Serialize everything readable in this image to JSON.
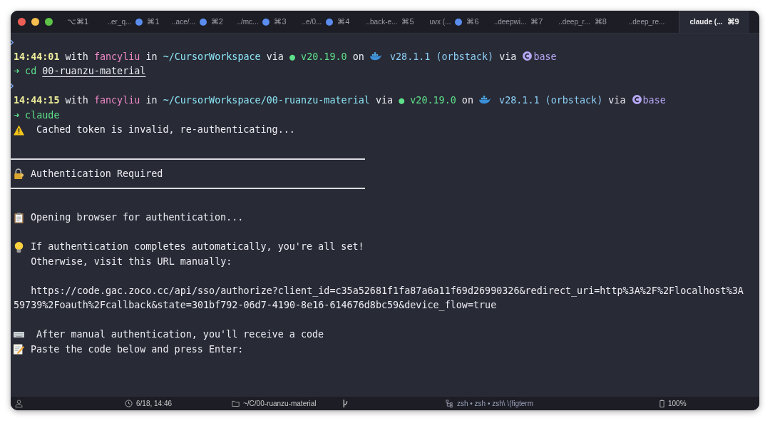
{
  "window": {
    "label": "⌥⌘1"
  },
  "tabs": [
    {
      "title": "..er_q...",
      "dot": true,
      "shortcut": "⌘1",
      "selected": false
    },
    {
      "title": "..ace/...",
      "dot": true,
      "shortcut": "⌘2",
      "selected": false
    },
    {
      "title": "../mc...",
      "dot": true,
      "shortcut": "⌘3",
      "selected": false
    },
    {
      "title": "..e/0...",
      "dot": true,
      "shortcut": "⌘4",
      "selected": false
    },
    {
      "title": "..back-e...",
      "dot": false,
      "shortcut": "⌘5",
      "selected": false
    },
    {
      "title": "uvx (...",
      "dot": true,
      "shortcut": "⌘6",
      "selected": false
    },
    {
      "title": "..deepwi...",
      "dot": false,
      "shortcut": "⌘7",
      "selected": false
    },
    {
      "title": "..deep_r...",
      "dot": false,
      "shortcut": "⌘8",
      "selected": false
    },
    {
      "title": "..deep_re...",
      "dot": false,
      "selected": false
    },
    {
      "title": "claude (...",
      "dot": false,
      "shortcut": "⌘9",
      "selected": true
    }
  ],
  "terminal": {
    "lines": [
      {
        "kind": "mark"
      },
      {
        "kind": "text",
        "segments": [
          {
            "kind": "time",
            "text": "14:44:01"
          },
          {
            "kind": "plain",
            "text": " with "
          },
          {
            "kind": "user",
            "text": "fancyliu"
          },
          {
            "kind": "plain",
            "text": " in "
          },
          {
            "kind": "path",
            "text": "~/CursorWorkspace"
          },
          {
            "kind": "plain",
            "text": " via "
          },
          {
            "kind": "node",
            "text": "● v20.19.0"
          },
          {
            "kind": "plain",
            "text": " on "
          },
          {
            "kind": "whale"
          },
          {
            "kind": "docker",
            "text": " v28.1.1 (orbstack)"
          },
          {
            "kind": "plain",
            "text": " via "
          },
          {
            "kind": "conda"
          },
          {
            "kind": "env",
            "text": "base"
          }
        ]
      },
      {
        "kind": "text",
        "segments": [
          {
            "kind": "command",
            "text": "➜ cd "
          },
          {
            "kind": "arg",
            "text": "00-ruanzu-material"
          }
        ]
      },
      {
        "kind": "mark"
      },
      {
        "kind": "text",
        "segments": [
          {
            "kind": "time",
            "text": "14:44:15"
          },
          {
            "kind": "plain",
            "text": " with "
          },
          {
            "kind": "user",
            "text": "fancyliu"
          },
          {
            "kind": "plain",
            "text": " in "
          },
          {
            "kind": "path",
            "text": "~/CursorWorkspace/00-ruanzu-material"
          },
          {
            "kind": "plain",
            "text": " via "
          },
          {
            "kind": "node",
            "text": "● v20.19.0"
          },
          {
            "kind": "plain",
            "text": " on "
          },
          {
            "kind": "whale"
          },
          {
            "kind": "docker",
            "text": " v28.1.1 (orbstack)"
          },
          {
            "kind": "plain",
            "text": " via "
          },
          {
            "kind": "conda"
          },
          {
            "kind": "env",
            "text": "base"
          }
        ]
      },
      {
        "kind": "text",
        "segments": [
          {
            "kind": "command",
            "text": "➜ claude"
          }
        ]
      },
      {
        "kind": "warning",
        "segments": [
          {
            "kind": "plain",
            "text": " Cached token is invalid, re-authenticating..."
          }
        ]
      },
      {
        "kind": "blank"
      },
      {
        "kind": "rule"
      },
      {
        "kind": "lock",
        "segments": [
          {
            "kind": "plain",
            "text": "Authentication Required"
          }
        ]
      },
      {
        "kind": "rule"
      },
      {
        "kind": "blank"
      },
      {
        "kind": "clipboard",
        "segments": [
          {
            "kind": "plain",
            "text": "Opening browser for authentication..."
          }
        ]
      },
      {
        "kind": "blank"
      },
      {
        "kind": "bulb",
        "segments": [
          {
            "kind": "plain",
            "text": "If authentication completes automatically, you're all set!"
          }
        ]
      },
      {
        "kind": "text",
        "segments": [
          {
            "kind": "plain",
            "text": "   Otherwise, visit this URL manually:"
          }
        ]
      },
      {
        "kind": "blank"
      },
      {
        "kind": "text",
        "segments": [
          {
            "kind": "plain",
            "text": "   https://code.gac.zoco.cc/api/sso/authorize?client_id=c35a52681f1fa87a6a11f69d26990326&redirect_uri=http%3A%2F%2Flocalhost%3A"
          }
        ]
      },
      {
        "kind": "text",
        "segments": [
          {
            "kind": "plain",
            "text": "59739%2Foauth%2Fcallback&state=301bf792-06d7-4190-8e16-614676d8bc59&device_flow=true"
          }
        ]
      },
      {
        "kind": "blank"
      },
      {
        "kind": "keyboard",
        "segments": [
          {
            "kind": "plain",
            "text": " After manual authentication, you'll receive a code"
          }
        ]
      },
      {
        "kind": "memo",
        "segments": [
          {
            "kind": "plain",
            "text": "Paste the code below and press Enter:"
          }
        ]
      }
    ]
  },
  "status_bar": [
    {
      "kind": "person"
    },
    {
      "kind": "clock",
      "text": "6/18, 14:46"
    },
    {
      "kind": "folder",
      "text": "~/C/00-ruanzu-material"
    },
    {
      "kind": "branch"
    },
    {
      "kind": "tree",
      "text": "zsh • zsh • zsh\\ \\(figterm"
    },
    {
      "kind": "battery",
      "text": "100%"
    }
  ]
}
